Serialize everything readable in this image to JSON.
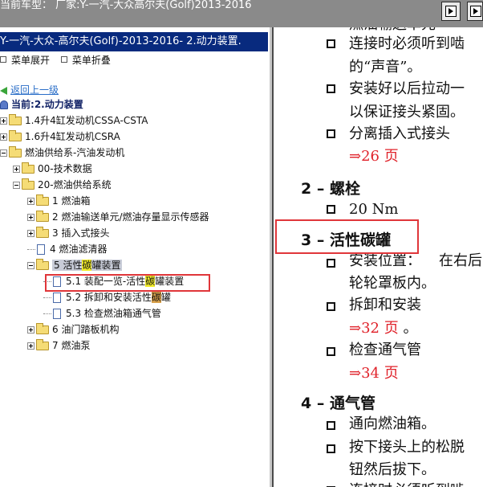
{
  "titlebar": {
    "title": "当前车型：  厂家:Y-一汽-大众高尔夫(Golf)2013-2016"
  },
  "left": {
    "header": "Y-一汽-大众-高尔夫(Golf)-2013-2016- 2.动力装置.",
    "expand_all": "菜单展开",
    "collapse_all": "菜单折叠",
    "back_link": "返回上一级",
    "current_prefix": "当前:",
    "current_label": "2.动力装置",
    "tree": [
      {
        "label": "1.4升4缸发动机CSSA-CSTA"
      },
      {
        "label": "1.6升4缸发动机CSRA"
      },
      {
        "label": "燃油供给系-汽油发动机"
      },
      {
        "label": "00-技术数据"
      },
      {
        "label": "20-燃油供给系统"
      },
      {
        "label": "1 燃油箱"
      },
      {
        "label": "2 燃油输送单元/燃油存量显示传感器"
      },
      {
        "label": "3 插入式接头"
      },
      {
        "label": "4 燃油滤清器"
      },
      {
        "label_a": "5 活性",
        "label_hl": "碳",
        "label_b": "罐装置"
      },
      {
        "label_a": "5.1 装配一览-活性",
        "label_hl": "碳",
        "label_b": "罐装置"
      },
      {
        "label_a": "5.2 拆卸和安装活性",
        "label_hl": "碳",
        "label_b": "罐"
      },
      {
        "label": "5.3 检查燃油箱通气管"
      },
      {
        "label": "6 油门踏板机构"
      },
      {
        "label": "7 燃油泵"
      }
    ]
  },
  "right": {
    "top_partial": "燃油输送单元",
    "b1": "连接时必须听到啮",
    "b1b": "的“声音”。",
    "b2": "安装好以后拉动一",
    "b2b": "以保证接头紧固。",
    "b3": "分离插入式接头",
    "ref1": "⇒26 页",
    "h2": "2 – 螺栓",
    "b4": "20 Nm",
    "h3": "3 – 活性碳罐",
    "b5a": "安装位置：",
    "b5c": "在右后",
    "b5b": "轮轮罩板内。",
    "b6": "拆卸和安装",
    "ref2": "⇒32 页",
    "ref2_suffix": " 。",
    "b7": "检查通气管",
    "ref3": "⇒34 页",
    "h4": "4 – 通气管",
    "b8": "通向燃油箱。",
    "b9": "按下接头上的松脱",
    "b9b": "钮然后拔下。",
    "b10": "连接时必须听到啮"
  }
}
